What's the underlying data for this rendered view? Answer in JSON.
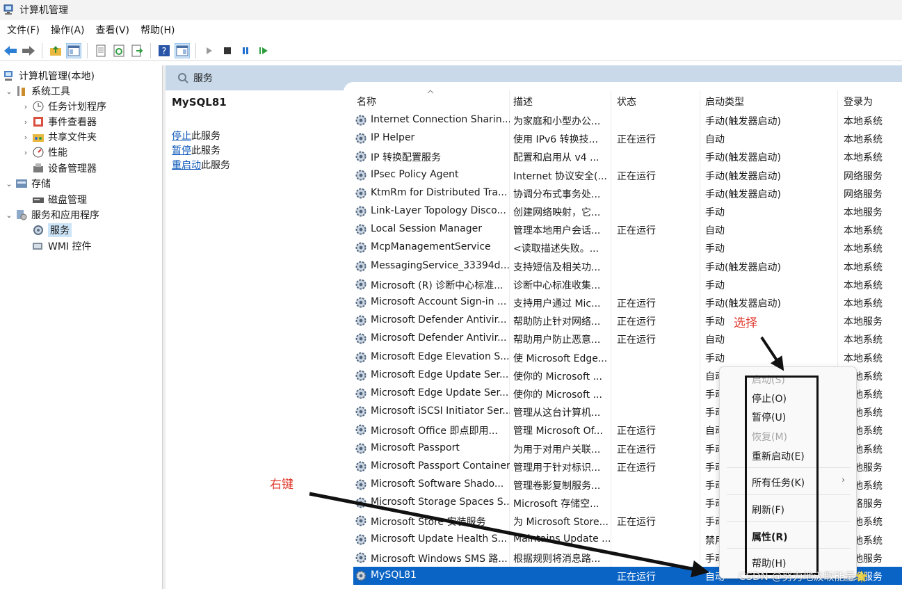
{
  "window": {
    "title": "计算机管理"
  },
  "menu": [
    "文件(F)",
    "操作(A)",
    "查看(V)",
    "帮助(H)"
  ],
  "tree": [
    {
      "label": "计算机管理(本地)",
      "expander": "",
      "icon": "computer-mgmt-icon",
      "indent": 0
    },
    {
      "label": "系统工具",
      "expander": "⌄",
      "icon": "tools-icon",
      "indent": 1
    },
    {
      "label": "任务计划程序",
      "expander": "›",
      "icon": "clock-icon",
      "indent": 2
    },
    {
      "label": "事件查看器",
      "expander": "›",
      "icon": "event-viewer-icon",
      "indent": 2
    },
    {
      "label": "共享文件夹",
      "expander": "›",
      "icon": "shared-folder-icon",
      "indent": 2
    },
    {
      "label": "性能",
      "expander": "›",
      "icon": "performance-icon",
      "indent": 2
    },
    {
      "label": "设备管理器",
      "expander": "",
      "icon": "device-manager-icon",
      "indent": 2
    },
    {
      "label": "存储",
      "expander": "⌄",
      "icon": "storage-icon",
      "indent": 1
    },
    {
      "label": "磁盘管理",
      "expander": "",
      "icon": "disk-icon",
      "indent": 2
    },
    {
      "label": "服务和应用程序",
      "expander": "⌄",
      "icon": "services-apps-icon",
      "indent": 1
    },
    {
      "label": "服务",
      "expander": "",
      "icon": "services-icon",
      "indent": 2,
      "selected": true
    },
    {
      "label": "WMI 控件",
      "expander": "",
      "icon": "wmi-icon",
      "indent": 2
    }
  ],
  "band": {
    "title": "服务"
  },
  "desc": {
    "service_name": "MySQL81",
    "stop_link": "停止",
    "stop_suffix": "此服务",
    "pause_link": "暂停",
    "pause_suffix": "此服务",
    "restart_link": "重启动",
    "restart_suffix": "此服务"
  },
  "columns": [
    "名称",
    "描述",
    "状态",
    "启动类型",
    "登录为"
  ],
  "rows": [
    [
      "Internet Connection Sharin...",
      "为家庭和小型办公...",
      "",
      "手动(触发器启动)",
      "本地系统"
    ],
    [
      "IP Helper",
      "使用 IPv6 转换技...",
      "正在运行",
      "自动",
      "本地系统"
    ],
    [
      "IP 转换配置服务",
      "配置和启用从 v4 ...",
      "",
      "手动(触发器启动)",
      "本地系统"
    ],
    [
      "IPsec Policy Agent",
      "Internet 协议安全(...",
      "正在运行",
      "手动(触发器启动)",
      "网络服务"
    ],
    [
      "KtmRm for Distributed Tra...",
      "协调分布式事务处...",
      "",
      "手动(触发器启动)",
      "网络服务"
    ],
    [
      "Link-Layer Topology Disco...",
      "创建网络映射，它...",
      "",
      "手动",
      "本地服务"
    ],
    [
      "Local Session Manager",
      "管理本地用户会话...",
      "正在运行",
      "自动",
      "本地系统"
    ],
    [
      "McpManagementService",
      "<读取描述失败。...",
      "",
      "手动",
      "本地系统"
    ],
    [
      "MessagingService_33394d...",
      "支持短信及相关功...",
      "",
      "手动(触发器启动)",
      "本地系统"
    ],
    [
      "Microsoft (R) 诊断中心标准...",
      "诊断中心标准收集...",
      "",
      "手动",
      "本地系统"
    ],
    [
      "Microsoft Account Sign-in ...",
      "支持用户通过 Mic...",
      "正在运行",
      "手动(触发器启动)",
      "本地系统"
    ],
    [
      "Microsoft Defender Antivir...",
      "帮助防止针对网络...",
      "正在运行",
      "手动",
      "本地服务"
    ],
    [
      "Microsoft Defender Antivir...",
      "帮助用户防止恶意...",
      "正在运行",
      "自动",
      "本地系统"
    ],
    [
      "Microsoft Edge Elevation S...",
      "使 Microsoft Edge...",
      "",
      "手动",
      "本地系统"
    ],
    [
      "Microsoft Edge Update Ser...",
      "使你的 Microsoft ...",
      "",
      "自动",
      "本地系统"
    ],
    [
      "Microsoft Edge Update Ser...",
      "使你的 Microsoft ...",
      "",
      "手动",
      "本地系统"
    ],
    [
      "Microsoft iSCSI Initiator Ser...",
      "管理从这台计算机...",
      "",
      "手动",
      "本地系统"
    ],
    [
      "Microsoft Office 即点即用...",
      "管理 Microsoft Of...",
      "正在运行",
      "自动",
      "本地系统"
    ],
    [
      "Microsoft Passport",
      "为用于对用户关联...",
      "正在运行",
      "手动",
      "本地系统"
    ],
    [
      "Microsoft Passport Container",
      "管理用于针对标识...",
      "正在运行",
      "手动",
      "本地服务"
    ],
    [
      "Microsoft Software Shado...",
      "管理卷影复制服务...",
      "",
      "手动",
      "本地系统"
    ],
    [
      "Microsoft Storage Spaces S...",
      "Microsoft 存储空...",
      "",
      "手动",
      "网络服务"
    ],
    [
      "Microsoft Store 安装服务",
      "为 Microsoft Store...",
      "正在运行",
      "手动",
      "本地系统"
    ],
    [
      "Microsoft Update Health S...",
      "Maintains Update ...",
      "",
      "禁用",
      "本地系统"
    ],
    [
      "Microsoft Windows SMS 路...",
      "根据规则将消息路...",
      "",
      "手动",
      "本地服务"
    ],
    [
      "MySQL81",
      "",
      "正在运行",
      "自动",
      "网络服务"
    ]
  ],
  "selected_row": 25,
  "context_menu": {
    "start": "启动(S)",
    "stop": "停止(O)",
    "pause": "暂停(U)",
    "resume": "恢复(M)",
    "restart": "重新启动(E)",
    "all_tasks": "所有任务(K)",
    "refresh": "刷新(F)",
    "properties": "属性(R)",
    "help": "帮助(H)"
  },
  "annotations": {
    "select": "选择",
    "right_click": "右键",
    "watermark": "CSDN @努力地汲取能量🌟"
  },
  "colors": {
    "selection": "#0a64c6",
    "band": "#c9d9ea",
    "annotation": "#e03a2e"
  }
}
